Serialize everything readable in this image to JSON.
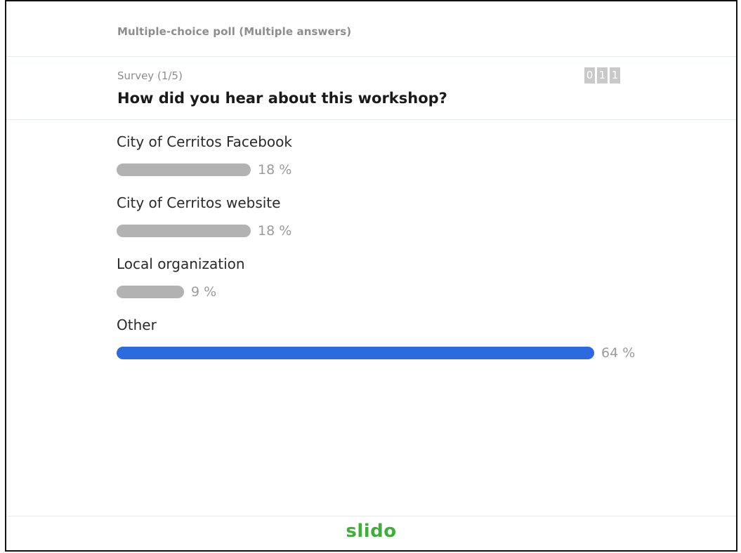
{
  "header": {
    "poll_type": "Multiple-choice poll (Multiple answers)"
  },
  "question": {
    "survey_label": "Survey (1/5)",
    "title": "How did you hear about this workshop?",
    "vote_counter": [
      "0",
      "1",
      "1"
    ]
  },
  "options": [
    {
      "label": "City of Cerritos Facebook",
      "percent": 18,
      "percent_label": "18 %",
      "highlighted": false
    },
    {
      "label": "City of Cerritos website",
      "percent": 18,
      "percent_label": "18 %",
      "highlighted": false
    },
    {
      "label": "Local organization",
      "percent": 9,
      "percent_label": "9 %",
      "highlighted": false
    },
    {
      "label": "Other",
      "percent": 64,
      "percent_label": "64 %",
      "highlighted": true
    }
  ],
  "colors": {
    "bar_default": "#b2b2b2",
    "bar_highlight": "#2c6ae0",
    "brand": "#3fae3a"
  },
  "footer": {
    "brand": "slido"
  }
}
